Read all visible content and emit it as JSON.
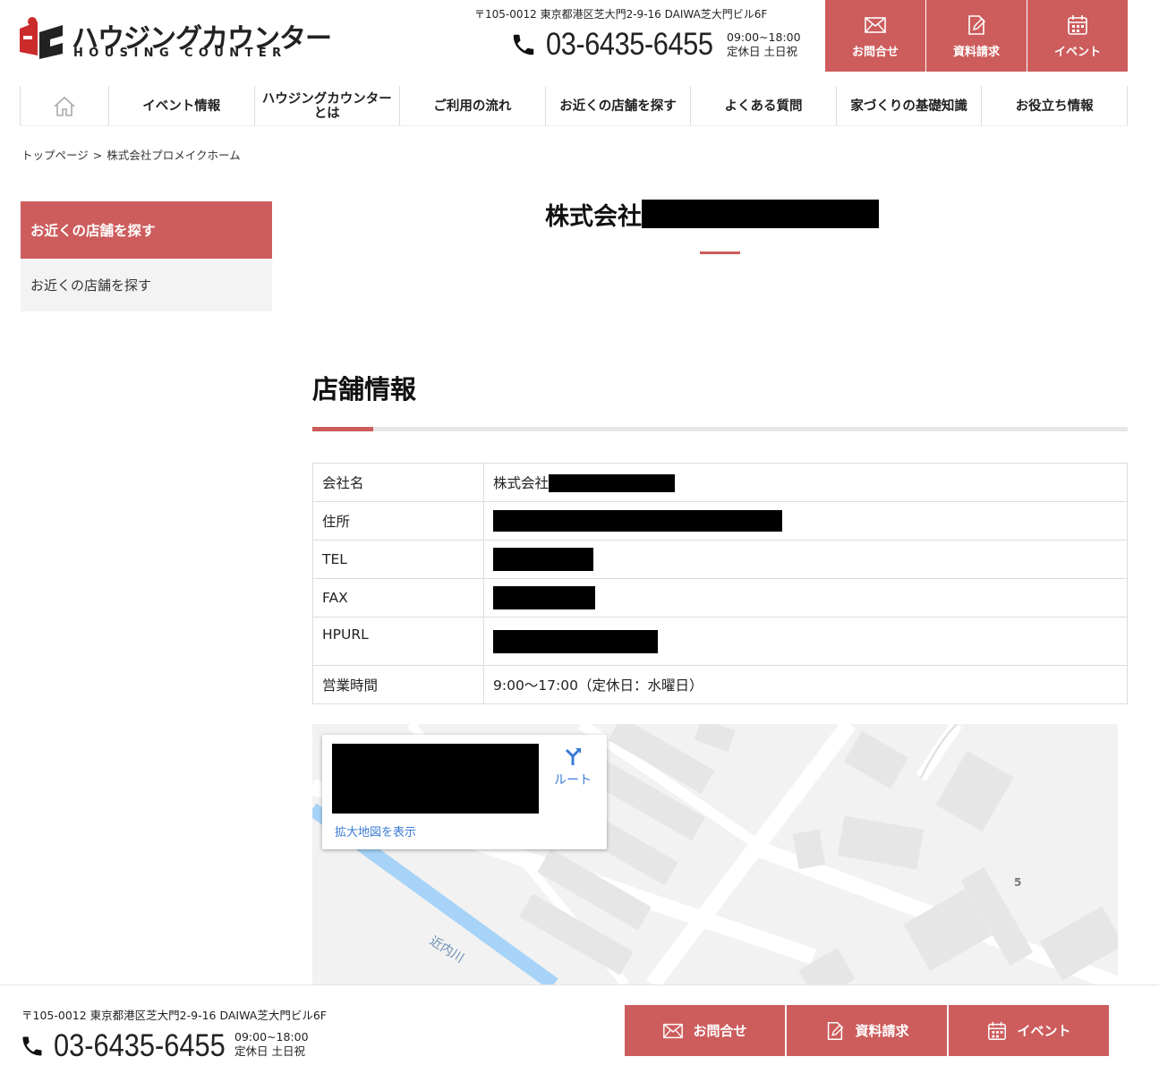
{
  "header": {
    "logo_jp": "ハウジングカウンター",
    "logo_en": "HOUSING COUNTER",
    "address": "〒105-0012 東京都港区芝大門2-9-16 DAIWA芝大門ビル6F",
    "phone": "03-6435-6455",
    "hours": "09:00~18:00",
    "closed": "定休日 土日祝",
    "buttons": [
      {
        "label": "お問合せ",
        "icon": "mail-icon"
      },
      {
        "label": "資料請求",
        "icon": "document-edit-icon"
      },
      {
        "label": "イベント",
        "icon": "calendar-icon"
      }
    ]
  },
  "nav": {
    "home_icon": "home-icon",
    "items": [
      "イベント情報",
      "ハウジングカウンター",
      "とは",
      "ご利用の流れ",
      "お近くの店舗を探す",
      "よくある質問",
      "家づくりの基礎知識",
      "お役立ち情報"
    ]
  },
  "breadcrumb": {
    "home": "トップページ",
    "separator": ">",
    "current": "株式会社プロメイクホーム"
  },
  "sidebar": {
    "heading": "お近くの店舗を探す",
    "item": "お近くの店舗を探す"
  },
  "main": {
    "title_prefix": "株式会社",
    "section_title": "店舗情報",
    "table": [
      {
        "key": "会社名",
        "value": "株式会社"
      },
      {
        "key": "住所",
        "value": ""
      },
      {
        "key": "TEL",
        "value": ""
      },
      {
        "key": "FAX",
        "value": ""
      },
      {
        "key": "HPURL",
        "value": ""
      },
      {
        "key": "営業時間",
        "value": "9:00～17:00（定休日：水曜日）"
      }
    ]
  },
  "map": {
    "route_label": "ルート",
    "expand_link": "拡大地図を表示",
    "river_label": "近内川",
    "number_label": "5"
  },
  "footer": {
    "address": "〒105-0012 東京都港区芝大門2-9-16 DAIWA芝大門ビル6F",
    "phone": "03-6435-6455",
    "hours": "09:00~18:00",
    "closed": "定休日 土日祝",
    "buttons": [
      {
        "label": "お問合せ",
        "icon": "mail-icon"
      },
      {
        "label": "資料請求",
        "icon": "document-edit-icon"
      },
      {
        "label": "イベント",
        "icon": "calendar-icon"
      }
    ]
  },
  "colors": {
    "accent": "#cd5c5c",
    "link": "#3a7bd5",
    "river": "#9fcff5"
  }
}
